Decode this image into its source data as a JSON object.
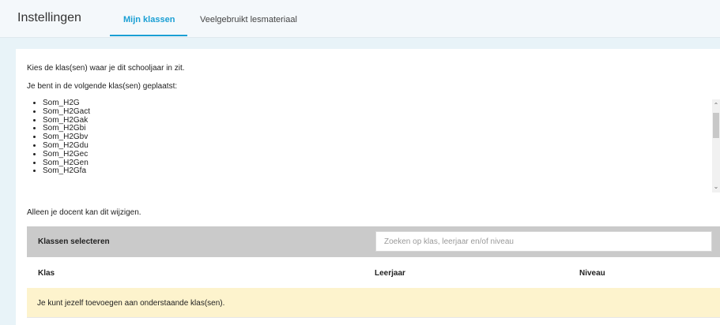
{
  "header": {
    "title": "Instellingen",
    "tabs": [
      {
        "label": "Mijn klassen",
        "active": true
      },
      {
        "label": "Veelgebruikt lesmateriaal",
        "active": false
      }
    ]
  },
  "content": {
    "intro": "Kies de klas(sen) waar je dit schooljaar in zit.",
    "placed_label": "Je bent in de volgende klas(sen) geplaatst:",
    "classes": [
      "Som_H2G",
      "Som_H2Gact",
      "Som_H2Gak",
      "Som_H2Gbi",
      "Som_H2Gbv",
      "Som_H2Gdu",
      "Som_H2Gec",
      "Som_H2Gen",
      "Som_H2Gfa"
    ],
    "only_teacher_note": "Alleen je docent kan dit wijzigen."
  },
  "selector": {
    "title": "Klassen selecteren",
    "search_placeholder": "Zoeken op klas, leerjaar en/of niveau",
    "columns": [
      "Klas",
      "Leerjaar",
      "Niveau"
    ],
    "notice": "Je kunt jezelf toevoegen aan onderstaande klas(sen)."
  },
  "colors": {
    "accent": "#1a9fd4",
    "notice_bg": "#fdf3cd",
    "bar_bg": "#cacaca"
  }
}
